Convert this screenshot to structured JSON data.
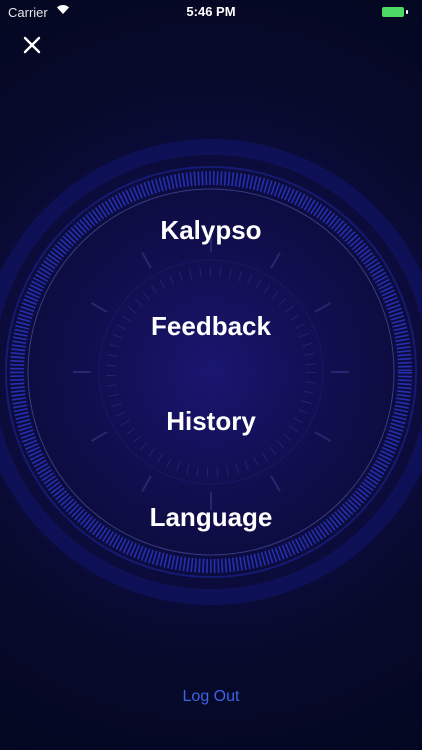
{
  "status_bar": {
    "carrier": "Carrier",
    "time": "5:46 PM"
  },
  "menu": {
    "items": [
      {
        "label": "Kalypso"
      },
      {
        "label": "Feedback"
      },
      {
        "label": "History"
      },
      {
        "label": "Language"
      }
    ]
  },
  "footer": {
    "logout_label": "Log Out"
  },
  "icons": {
    "close": "close-icon",
    "wifi": "wifi-icon",
    "battery": "battery-icon"
  },
  "colors": {
    "background": "#070a2c",
    "accent_link": "#3d63e6",
    "battery": "#4cd964"
  }
}
